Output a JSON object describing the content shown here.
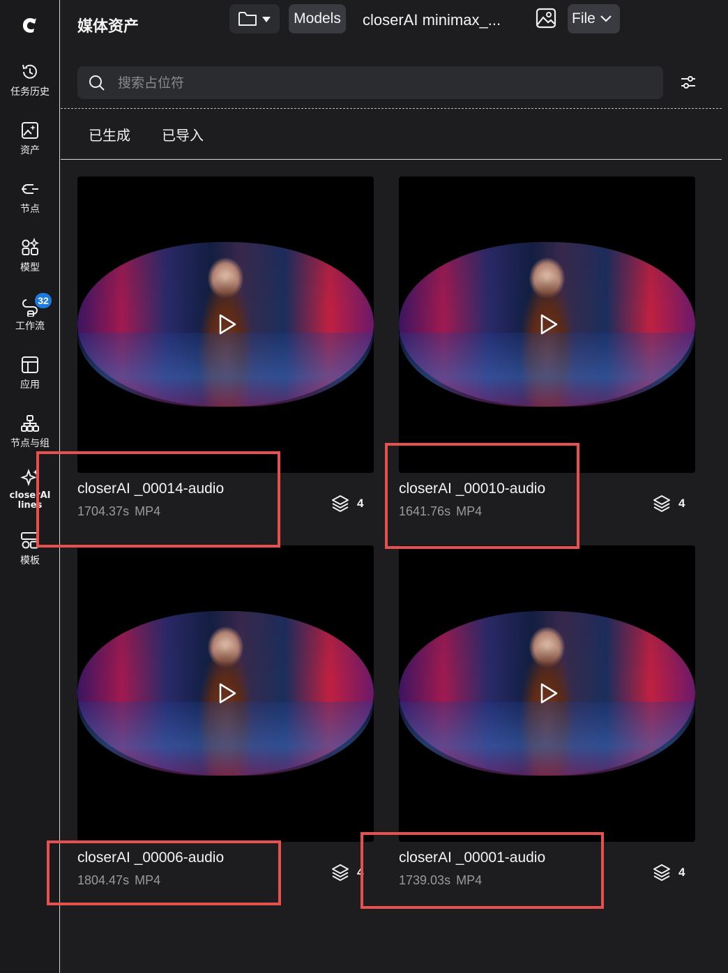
{
  "sidebar": {
    "items": [
      {
        "label": "任务历史",
        "icon": "history-icon"
      },
      {
        "label": "资产",
        "icon": "assets-icon"
      },
      {
        "label": "节点",
        "icon": "node-icon"
      },
      {
        "label": "模型",
        "icon": "models-icon"
      },
      {
        "label": "工作流",
        "icon": "workflow-icon",
        "badge": "32"
      },
      {
        "label": "应用",
        "icon": "apps-icon"
      },
      {
        "label": "节点与组",
        "icon": "node-groups-icon"
      },
      {
        "label": "closerAI lines",
        "icon": "sparkle-icon"
      },
      {
        "label": "模板",
        "icon": "templates-icon"
      }
    ]
  },
  "header": {
    "title": "媒体资产",
    "models_label": "Models",
    "project_name": "closerAI minimax_...",
    "file_label": "File"
  },
  "search": {
    "placeholder": "搜索占位符"
  },
  "tabs": [
    {
      "label": "已生成"
    },
    {
      "label": "已导入"
    }
  ],
  "assets": [
    {
      "title": "closerAI _00014-audio",
      "duration": "1704.37s",
      "format": "MP4",
      "layers": "4"
    },
    {
      "title": "closerAI _00010-audio",
      "duration": "1641.76s",
      "format": "MP4",
      "layers": "4"
    },
    {
      "title": "closerAI _00006-audio",
      "duration": "1804.47s",
      "format": "MP4",
      "layers": "4"
    },
    {
      "title": "closerAI _00001-audio",
      "duration": "1739.03s",
      "format": "MP4",
      "layers": "4"
    }
  ],
  "colors": {
    "accent_badge": "#1f7ae0",
    "highlight": "#e8504f",
    "background": "#1d1d1f"
  }
}
